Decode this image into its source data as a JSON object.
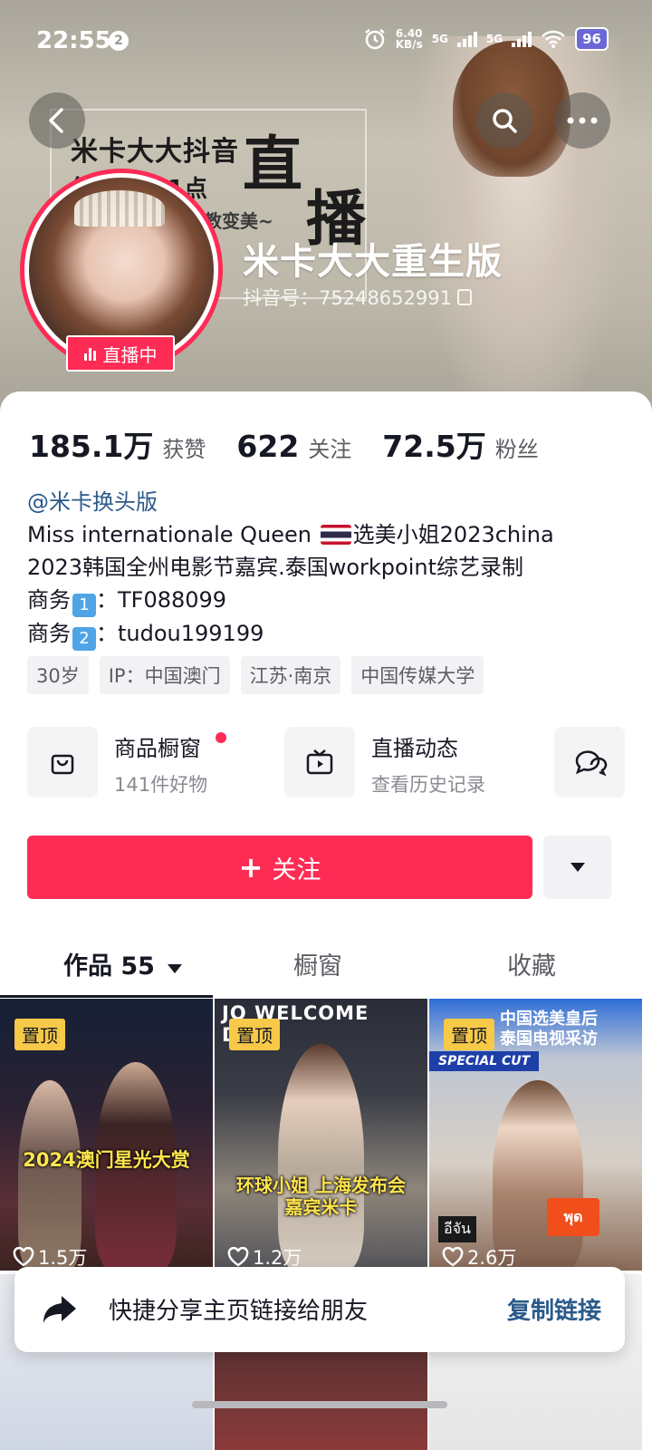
{
  "status_bar": {
    "time": "22:55",
    "notification_count": "2",
    "net_speed": "6.40",
    "net_unit": "KB/s",
    "signal1": "5G",
    "signal2": "5G",
    "battery": "96"
  },
  "header": {
    "poster_line1": "米卡大大抖音",
    "poster_line2": "每晚9点-1点",
    "poster_line3": "教变美~",
    "poster_big1": "直",
    "poster_big2": "播",
    "nickname": "米卡大大重生版",
    "douyin_id": "抖音号：75248652991",
    "live_label": "直播中"
  },
  "stats": [
    {
      "value": "185.1万",
      "label": "获赞"
    },
    {
      "value": "622",
      "label": "关注"
    },
    {
      "value": "72.5万",
      "label": "粉丝"
    }
  ],
  "bio": {
    "mention": "@米卡换头版",
    "line1_a": "Miss internationale Queen ",
    "line1_b": "选美小姐2023china",
    "line2": "2023韩国全州电影节嘉宾.泰国workpoint综艺录制",
    "biz1_label": "商务",
    "biz1_num": "1",
    "biz1_value": "：TF088099",
    "biz2_label": "商务",
    "biz2_num": "2",
    "biz2_value": "：tudou199199"
  },
  "tags": [
    "30岁",
    "IP：中国澳门",
    "江苏·南京",
    "中国传媒大学"
  ],
  "shortcuts": {
    "shop_title": "商品橱窗",
    "shop_sub": "141件好物",
    "live_title": "直播动态",
    "live_sub": "查看历史记录"
  },
  "actions": {
    "follow_plus": "+",
    "follow_label": "关注"
  },
  "tabs": [
    {
      "label": "作品 55"
    },
    {
      "label": "橱窗"
    },
    {
      "label": "收藏"
    }
  ],
  "videos": [
    {
      "pin": "置顶",
      "caption": "2024澳门星光大赏",
      "likes": "1.5万"
    },
    {
      "pin": "置顶",
      "caption1": "环球小姐 上海发布会",
      "caption2": "嘉宾米卡",
      "banner": "JO WELCOME DINN",
      "likes": "1.2万"
    },
    {
      "pin": "置顶",
      "tv1": "中国选美皇后",
      "tv2": "泰国电视采访",
      "special": "SPECIAL CUT",
      "mic": "พุด",
      "thai": "อีจัน",
      "likes": "2.6万"
    }
  ],
  "toast": {
    "text": "快捷分享主页链接给朋友",
    "link": "复制链接"
  },
  "colors": {
    "accent": "#fe2c55",
    "link": "#2b5a8a",
    "pin": "#f7c948"
  }
}
